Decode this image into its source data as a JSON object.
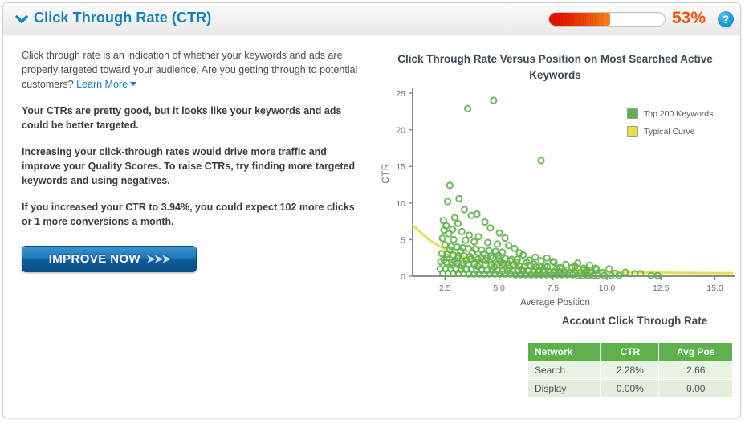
{
  "header": {
    "title": "Click Through Rate (CTR)",
    "collapse_icon": "chevron-down-icon",
    "score_percent": "53%",
    "score_value": 53,
    "help_icon": "?",
    "accent_blue": "#1180c4",
    "score_color": "#f4500a"
  },
  "info": {
    "intro": "Click through rate is an indication of whether your keywords and ads are properly targeted toward your audience. Are you getting through to potential customers?",
    "learn_more": "Learn More",
    "verdict": "Your CTRs are pretty good, but it looks like your keywords and ads could be better targeted.",
    "advice": "Increasing your click-through rates would drive more traffic and improve your Quality Scores. To raise CTRs, try finding more targeted keywords and using negatives.",
    "projection": "If you increased your CTR to 3.94%, you could expect 102 more clicks or 1 more conversions a month.",
    "cta_label": "IMPROVE NOW",
    "cta_arrows": "➤➤➤"
  },
  "table": {
    "title": "Account Click Through Rate",
    "columns": [
      "Network",
      "CTR",
      "Avg Pos"
    ],
    "rows": [
      [
        "Search",
        "2.28%",
        "2.66"
      ],
      [
        "Display",
        "0.00%",
        "0.00"
      ]
    ]
  },
  "chart_data": {
    "type": "scatter",
    "title": "Click Through Rate Versus Position on Most Searched Active Keywords",
    "xlabel": "Average Position",
    "ylabel": "CTR",
    "xlim": [
      1.0,
      15.8
    ],
    "ylim": [
      0,
      25
    ],
    "xticks": [
      2.5,
      5.0,
      7.5,
      10.0,
      12.5,
      15.0
    ],
    "yticks": [
      0,
      5,
      10,
      15,
      20,
      25
    ],
    "xtick_labels": [
      "2.5",
      "5.0",
      "7.5",
      "10.0",
      "12.5",
      "15.0"
    ],
    "ytick_labels": [
      "0",
      "5",
      "10",
      "15",
      "20",
      "25"
    ],
    "grid": false,
    "legend_position": "top-right",
    "legend": [
      {
        "name": "Top 200 Keywords",
        "color": "#5fb24b",
        "marker": "open-circle"
      },
      {
        "name": "Typical Curve",
        "color": "#e5dd4a",
        "marker": "line"
      }
    ],
    "series": [
      {
        "name": "Top 200 Keywords",
        "color": "#5fb24b",
        "marker": "open-circle",
        "points": [
          [
            3.55,
            22.9
          ],
          [
            4.75,
            24.0
          ],
          [
            6.95,
            15.8
          ],
          [
            2.45,
            6.3
          ],
          [
            2.72,
            12.4
          ],
          [
            3.15,
            10.6
          ],
          [
            2.62,
            10.2
          ],
          [
            3.4,
            9.1
          ],
          [
            3.72,
            8.3
          ],
          [
            2.95,
            8.0
          ],
          [
            2.42,
            7.6
          ],
          [
            3.98,
            8.5
          ],
          [
            3.1,
            7.2
          ],
          [
            2.55,
            6.9
          ],
          [
            2.85,
            6.4
          ],
          [
            4.35,
            7.4
          ],
          [
            4.6,
            6.6
          ],
          [
            3.28,
            6.1
          ],
          [
            2.68,
            5.8
          ],
          [
            3.62,
            5.6
          ],
          [
            4.05,
            5.4
          ],
          [
            2.38,
            5.2
          ],
          [
            2.9,
            5.0
          ],
          [
            3.45,
            4.9
          ],
          [
            3.85,
            4.7
          ],
          [
            4.48,
            4.6
          ],
          [
            5.02,
            5.9
          ],
          [
            5.28,
            5.2
          ],
          [
            4.92,
            4.4
          ],
          [
            2.5,
            4.3
          ],
          [
            2.78,
            4.1
          ],
          [
            3.05,
            4.0
          ],
          [
            3.32,
            3.9
          ],
          [
            3.58,
            3.8
          ],
          [
            3.9,
            3.7
          ],
          [
            4.2,
            3.6
          ],
          [
            4.55,
            3.5
          ],
          [
            4.85,
            3.4
          ],
          [
            5.15,
            3.3
          ],
          [
            5.45,
            4.2
          ],
          [
            5.72,
            3.8
          ],
          [
            5.95,
            3.2
          ],
          [
            2.35,
            3.1
          ],
          [
            2.6,
            3.0
          ],
          [
            2.88,
            2.9
          ],
          [
            3.12,
            2.8
          ],
          [
            3.38,
            2.8
          ],
          [
            3.65,
            2.7
          ],
          [
            3.92,
            2.6
          ],
          [
            4.18,
            2.6
          ],
          [
            4.45,
            2.5
          ],
          [
            4.72,
            2.5
          ],
          [
            5.0,
            2.4
          ],
          [
            5.3,
            2.4
          ],
          [
            5.58,
            2.3
          ],
          [
            5.85,
            2.3
          ],
          [
            6.12,
            2.9
          ],
          [
            6.4,
            2.2
          ],
          [
            6.68,
            2.6
          ],
          [
            6.95,
            2.1
          ],
          [
            7.22,
            2.5
          ],
          [
            7.5,
            2.0
          ],
          [
            2.3,
            2.0
          ],
          [
            2.56,
            1.9
          ],
          [
            2.82,
            1.9
          ],
          [
            3.08,
            1.8
          ],
          [
            3.34,
            1.8
          ],
          [
            3.6,
            1.7
          ],
          [
            3.86,
            1.7
          ],
          [
            4.12,
            1.7
          ],
          [
            4.38,
            1.6
          ],
          [
            4.64,
            1.6
          ],
          [
            4.9,
            1.6
          ],
          [
            5.16,
            1.5
          ],
          [
            5.42,
            1.5
          ],
          [
            5.68,
            1.5
          ],
          [
            5.94,
            1.4
          ],
          [
            6.2,
            1.4
          ],
          [
            6.46,
            1.4
          ],
          [
            6.72,
            1.3
          ],
          [
            6.98,
            1.3
          ],
          [
            7.24,
            1.3
          ],
          [
            7.55,
            1.9
          ],
          [
            7.82,
            1.2
          ],
          [
            8.1,
            1.6
          ],
          [
            8.38,
            1.2
          ],
          [
            8.65,
            1.8
          ],
          [
            8.92,
            1.1
          ],
          [
            9.2,
            1.5
          ],
          [
            9.48,
            1.1
          ],
          [
            2.28,
            1.0
          ],
          [
            2.52,
            1.0
          ],
          [
            2.76,
            1.0
          ],
          [
            3.0,
            0.9
          ],
          [
            3.24,
            0.9
          ],
          [
            3.48,
            0.9
          ],
          [
            3.72,
            0.9
          ],
          [
            3.96,
            0.8
          ],
          [
            4.2,
            0.8
          ],
          [
            4.44,
            0.8
          ],
          [
            4.68,
            0.8
          ],
          [
            4.92,
            0.8
          ],
          [
            5.16,
            0.7
          ],
          [
            5.4,
            0.7
          ],
          [
            5.64,
            0.7
          ],
          [
            5.88,
            0.7
          ],
          [
            6.12,
            0.7
          ],
          [
            6.36,
            0.7
          ],
          [
            6.6,
            0.6
          ],
          [
            6.84,
            0.6
          ],
          [
            7.08,
            0.6
          ],
          [
            7.32,
            0.6
          ],
          [
            7.56,
            0.6
          ],
          [
            7.8,
            0.6
          ],
          [
            8.04,
            0.6
          ],
          [
            8.28,
            0.5
          ],
          [
            8.52,
            0.5
          ],
          [
            8.76,
            0.5
          ],
          [
            9.0,
            0.5
          ],
          [
            9.24,
            0.5
          ],
          [
            9.52,
            0.9
          ],
          [
            9.8,
            0.5
          ],
          [
            10.1,
            1.0
          ],
          [
            10.38,
            0.4
          ],
          [
            2.4,
            0.4
          ],
          [
            2.64,
            0.4
          ],
          [
            2.88,
            0.4
          ],
          [
            3.12,
            0.4
          ],
          [
            3.36,
            0.4
          ],
          [
            3.6,
            0.3
          ],
          [
            3.84,
            0.3
          ],
          [
            4.08,
            0.3
          ],
          [
            4.32,
            0.3
          ],
          [
            4.56,
            0.3
          ],
          [
            4.8,
            0.3
          ],
          [
            5.04,
            0.3
          ],
          [
            5.28,
            0.3
          ],
          [
            5.52,
            0.3
          ],
          [
            5.76,
            0.2
          ],
          [
            6.0,
            0.2
          ],
          [
            6.24,
            0.2
          ],
          [
            6.48,
            0.2
          ],
          [
            6.72,
            0.2
          ],
          [
            6.96,
            0.2
          ],
          [
            7.2,
            0.2
          ],
          [
            7.44,
            0.2
          ],
          [
            7.68,
            0.2
          ],
          [
            7.92,
            0.2
          ],
          [
            8.16,
            0.2
          ],
          [
            8.4,
            0.2
          ],
          [
            8.64,
            0.1
          ],
          [
            8.88,
            0.1
          ],
          [
            9.12,
            0.1
          ],
          [
            9.36,
            0.1
          ],
          [
            9.6,
            0.1
          ],
          [
            9.88,
            0.1
          ],
          [
            10.2,
            0.1
          ],
          [
            10.55,
            0.1
          ],
          [
            11.3,
            0.35
          ],
          [
            11.55,
            0.35
          ],
          [
            12.05,
            0.1
          ],
          [
            12.35,
            0.1
          ],
          [
            10.85,
            0.55
          ],
          [
            8.95,
            0.85
          ],
          [
            7.68,
            1.1
          ],
          [
            6.28,
            1.9
          ],
          [
            5.52,
            2.1
          ],
          [
            4.98,
            2.85
          ],
          [
            4.28,
            3.05
          ],
          [
            3.78,
            3.25
          ],
          [
            3.22,
            3.45
          ],
          [
            2.72,
            3.65
          ],
          [
            2.45,
            2.25
          ],
          [
            2.95,
            2.05
          ],
          [
            3.5,
            2.15
          ],
          [
            4.02,
            2.35
          ],
          [
            4.62,
            2.75
          ],
          [
            5.22,
            1.75
          ],
          [
            5.82,
            1.85
          ],
          [
            6.62,
            1.65
          ],
          [
            7.12,
            1.45
          ],
          [
            7.92,
            0.95
          ],
          [
            8.52,
            1.35
          ],
          [
            9.05,
            0.75
          ],
          [
            6.05,
            0.95
          ],
          [
            6.85,
            0.85
          ],
          [
            5.48,
            1.15
          ],
          [
            4.78,
            1.25
          ],
          [
            4.02,
            1.35
          ],
          [
            3.28,
            1.45
          ],
          [
            2.82,
            1.55
          ],
          [
            2.58,
            2.55
          ],
          [
            3.08,
            2.45
          ],
          [
            3.68,
            2.35
          ],
          [
            4.38,
            2.15
          ],
          [
            5.08,
            1.95
          ]
        ]
      }
    ],
    "curve": {
      "name": "Typical Curve",
      "color": "#e5dd4a",
      "points": [
        [
          1.0,
          7.0
        ],
        [
          1.5,
          5.6
        ],
        [
          2.0,
          4.5
        ],
        [
          2.5,
          3.7
        ],
        [
          3.0,
          3.0
        ],
        [
          3.5,
          2.5
        ],
        [
          4.0,
          2.1
        ],
        [
          4.5,
          1.8
        ],
        [
          5.0,
          1.6
        ],
        [
          5.5,
          1.4
        ],
        [
          6.0,
          1.25
        ],
        [
          6.5,
          1.1
        ],
        [
          7.0,
          1.0
        ],
        [
          7.5,
          0.9
        ],
        [
          8.0,
          0.82
        ],
        [
          8.5,
          0.75
        ],
        [
          9.0,
          0.7
        ],
        [
          9.5,
          0.65
        ],
        [
          10.0,
          0.6
        ],
        [
          11.0,
          0.55
        ],
        [
          12.0,
          0.5
        ],
        [
          13.0,
          0.47
        ],
        [
          14.0,
          0.45
        ],
        [
          15.0,
          0.43
        ],
        [
          15.8,
          0.42
        ]
      ]
    }
  }
}
